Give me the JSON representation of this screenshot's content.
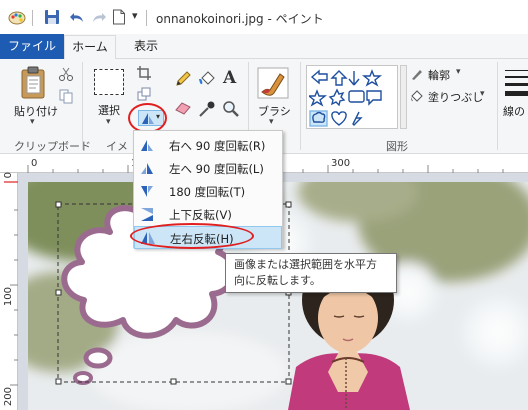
{
  "window": {
    "title": "onnanokoinori.jpg - ペイント"
  },
  "quick_access": {
    "dropdown_glyph": "▾"
  },
  "tabs": {
    "file": "ファイル",
    "home": "ホーム",
    "view": "表示"
  },
  "ribbon": {
    "clipboard": {
      "paste_label": "貼り付け",
      "group_label": "クリップボード"
    },
    "image": {
      "select_label": "選択",
      "group_label": "イメ"
    },
    "tools": {},
    "brushes": {
      "label": "ブラシ"
    },
    "shapes": {
      "outline_label": "輪郭",
      "fill_label": "塗りつぶし",
      "group_label": "図形"
    },
    "size": {
      "label": "線の"
    }
  },
  "ruler": {
    "top_marks": [
      "0",
      "100",
      "300"
    ],
    "left_marks": [
      "0",
      "100",
      "200"
    ]
  },
  "rotate_menu": {
    "items": [
      {
        "label": "右へ 90 度回転(R)",
        "icon": "rotate-right-icon"
      },
      {
        "label": "左へ 90 度回転(L)",
        "icon": "rotate-left-icon"
      },
      {
        "label": "180 度回転(T)",
        "icon": "rotate-180-icon"
      },
      {
        "label": "上下反転(V)",
        "icon": "flip-vertical-icon"
      },
      {
        "label": "左右反転(H)",
        "icon": "flip-horizontal-icon",
        "highlighted": true
      }
    ]
  },
  "tooltip": {
    "line1": "画像または選択範囲を水平方",
    "line2": "向に反転します。"
  },
  "colors": {
    "file_tab": "#1e5cb3",
    "ribbon_bg": "#f5f6f7",
    "annotation_red": "#e02020",
    "menu_highlight": "#cde6f7",
    "shape_blue": "#1f4f9f",
    "cloud_stroke": "#9b6b8f"
  }
}
